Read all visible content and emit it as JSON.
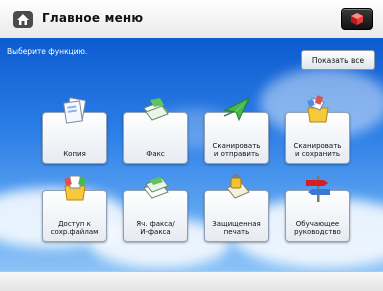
{
  "title": "Главное меню",
  "prompt": "Выберите функцию.",
  "show_all_label": "Показать все",
  "tiles": [
    {
      "label": "Копия",
      "icon": "copy-icon"
    },
    {
      "label": "Факс",
      "icon": "fax-icon"
    },
    {
      "label": "Сканировать\nи отправить",
      "icon": "scan-send-icon"
    },
    {
      "label": "Сканировать\nи сохранить",
      "icon": "scan-store-icon"
    },
    {
      "label": "Доступ к\nсохр.файлам",
      "icon": "stored-files-icon"
    },
    {
      "label": "Яч. факса/\nИ-факса",
      "icon": "fax-inbox-icon"
    },
    {
      "label": "Защищенная\nпечать",
      "icon": "secure-print-icon"
    },
    {
      "label": "Обучающее\nруководство",
      "icon": "tutorial-icon"
    }
  ],
  "colors": {
    "sky_top": "#0d5bd0",
    "sky_bottom": "#8cc3f6",
    "accent": "#d32020"
  }
}
